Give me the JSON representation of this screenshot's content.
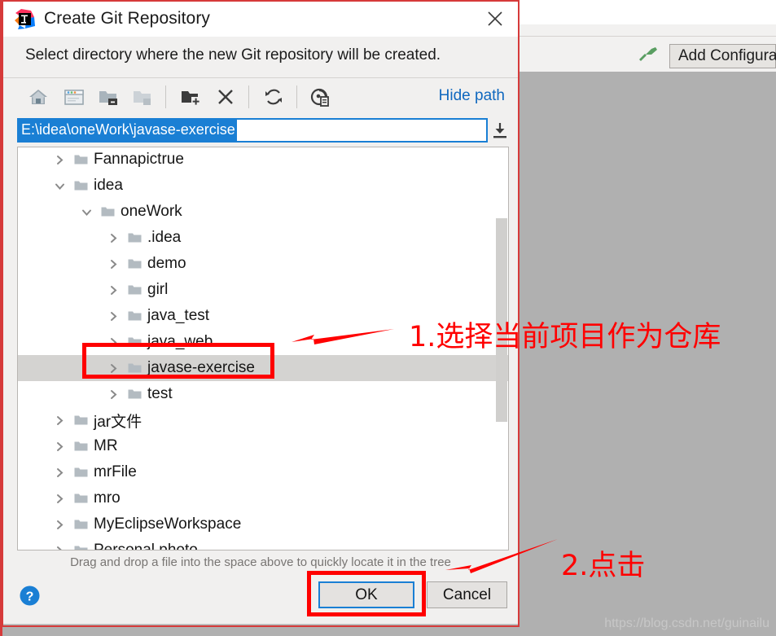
{
  "dialog": {
    "title": "Create Git Repository",
    "subtitle": "Select directory where the new Git repository will be created.",
    "close_label": "✕",
    "toolbar": {
      "icons": [
        {
          "name": "home-icon",
          "tooltip": "Home"
        },
        {
          "name": "desktop-icon",
          "tooltip": "Desktop"
        },
        {
          "name": "project-folder-icon",
          "tooltip": "Project Directory"
        },
        {
          "name": "module-folder-icon",
          "tooltip": "Module Directory"
        },
        {
          "name": "new-folder-icon",
          "tooltip": "New Folder"
        },
        {
          "name": "delete-icon",
          "tooltip": "Delete"
        },
        {
          "name": "refresh-icon",
          "tooltip": "Refresh"
        },
        {
          "name": "show-hidden-icon",
          "tooltip": "Show Hidden Files"
        }
      ],
      "hide_path_label": "Hide path"
    },
    "path_field": {
      "value": "E:\\idea\\oneWork\\javase-exercise",
      "placeholder": "",
      "selected": true,
      "download_icon": "download-icon"
    },
    "tree": {
      "items": [
        {
          "label": "Fannapictrue",
          "depth": 1,
          "expanded": false,
          "selected": false
        },
        {
          "label": "idea",
          "depth": 1,
          "expanded": true,
          "selected": false
        },
        {
          "label": "oneWork",
          "depth": 2,
          "expanded": true,
          "selected": false
        },
        {
          "label": ".idea",
          "depth": 3,
          "expanded": false,
          "selected": false
        },
        {
          "label": "demo",
          "depth": 3,
          "expanded": false,
          "selected": false
        },
        {
          "label": "girl",
          "depth": 3,
          "expanded": false,
          "selected": false
        },
        {
          "label": "java_test",
          "depth": 3,
          "expanded": false,
          "selected": false
        },
        {
          "label": "java_web",
          "depth": 3,
          "expanded": false,
          "selected": false
        },
        {
          "label": "javase-exercise",
          "depth": 3,
          "expanded": false,
          "selected": true
        },
        {
          "label": "test",
          "depth": 3,
          "expanded": false,
          "selected": false
        },
        {
          "label": "jar文件",
          "depth": 1,
          "expanded": false,
          "selected": false
        },
        {
          "label": "MR",
          "depth": 1,
          "expanded": false,
          "selected": false
        },
        {
          "label": "mrFile",
          "depth": 1,
          "expanded": false,
          "selected": false
        },
        {
          "label": "mro",
          "depth": 1,
          "expanded": false,
          "selected": false
        },
        {
          "label": "MyEclipseWorkspace",
          "depth": 1,
          "expanded": false,
          "selected": false
        },
        {
          "label": "Personal photo",
          "depth": 1,
          "expanded": false,
          "selected": false
        }
      ]
    },
    "hint": "Drag and drop a file into the space above to quickly locate it in the tree",
    "buttons": {
      "help": "?",
      "ok": "OK",
      "cancel": "Cancel"
    }
  },
  "ide": {
    "add_configuration_label": "Add Configura",
    "hammer_icon": "hammer-icon"
  },
  "annotations": {
    "step1": "1.选择当前项目作为仓库",
    "step2": "2.点击",
    "color": "#ff0000"
  },
  "watermark": "https://blog.csdn.net/guinailu"
}
